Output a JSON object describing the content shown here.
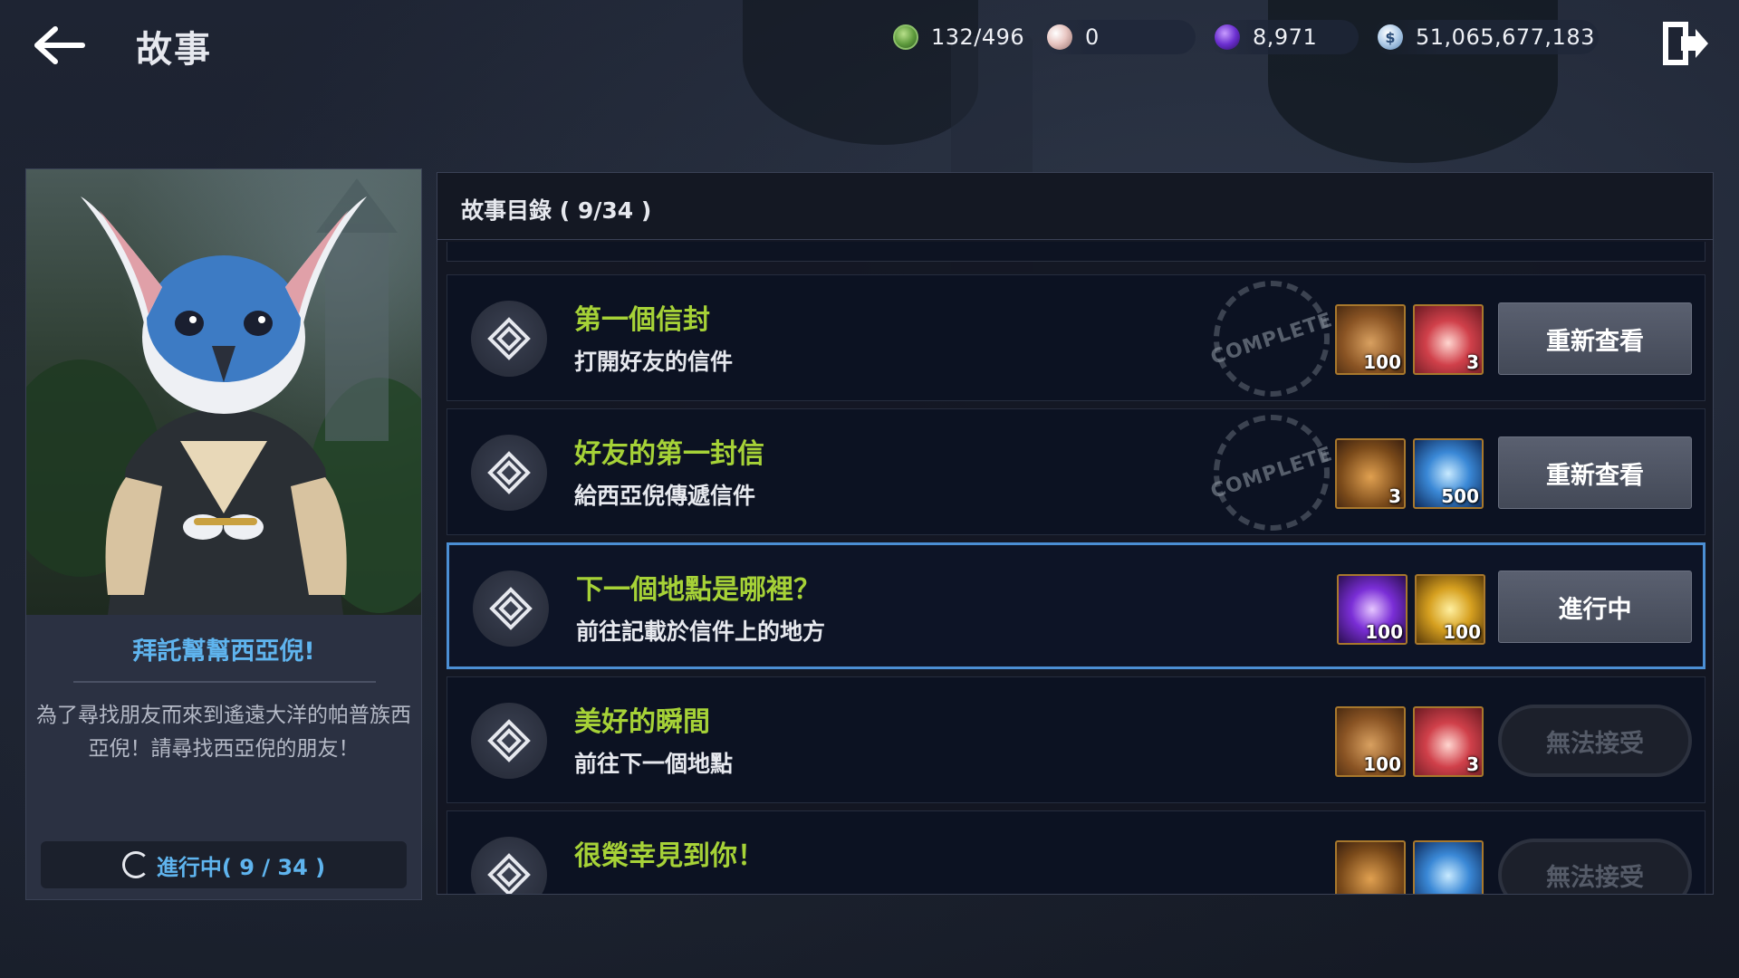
{
  "header": {
    "title": "故事",
    "back_icon": "back-arrow-icon",
    "exit_icon": "exit-icon"
  },
  "currencies": [
    {
      "name": "stamina",
      "value": "132/496"
    },
    {
      "name": "pearl",
      "value": "0"
    },
    {
      "name": "black-gem",
      "value": "8,971"
    },
    {
      "name": "silver",
      "value": "51,065,677,183"
    }
  ],
  "quest_info": {
    "title": "拜託幫幫西亞倪!",
    "description": "為了尋找朋友而來到遙遠大洋的帕普族西亞倪！請尋找西亞倪的朋友！",
    "progress": "進行中( 9 / 34 )"
  },
  "list": {
    "header": "故事目錄 ( 9/34 )",
    "stamp_text": "COMPLETE",
    "rows": [
      {
        "title": "第一個信封",
        "subtitle": "打開好友的信件",
        "completed": true,
        "rewards": [
          {
            "icon": "chest",
            "qty": "100"
          },
          {
            "icon": "gift-box",
            "qty": "3"
          }
        ],
        "action": "重新查看",
        "state": "completed"
      },
      {
        "title": "好友的第一封信",
        "subtitle": "給西亞倪傳遞信件",
        "completed": true,
        "rewards": [
          {
            "icon": "treasure-box",
            "qty": "3"
          },
          {
            "icon": "crystal",
            "qty": "500"
          }
        ],
        "action": "重新查看",
        "state": "completed"
      },
      {
        "title": "下一個地點是哪裡？",
        "subtitle": "前往記載於信件上的地方",
        "completed": false,
        "rewards": [
          {
            "icon": "purple-crystal",
            "qty": "100"
          },
          {
            "icon": "gold-trophy",
            "qty": "100"
          }
        ],
        "action": "進行中",
        "state": "active"
      },
      {
        "title": "美好的瞬間",
        "subtitle": "前往下一個地點",
        "completed": false,
        "rewards": [
          {
            "icon": "chest",
            "qty": "100"
          },
          {
            "icon": "gift-box",
            "qty": "3"
          }
        ],
        "action": "無法接受",
        "state": "locked"
      },
      {
        "title": "很榮幸見到你！",
        "subtitle": "",
        "completed": false,
        "rewards": [
          {
            "icon": "treasure-box",
            "qty": ""
          },
          {
            "icon": "crystal",
            "qty": ""
          }
        ],
        "action": "無法接受",
        "state": "locked"
      }
    ]
  },
  "colors": {
    "accent_blue": "#5fb4ee",
    "quest_title_green": "#a6d237",
    "active_border": "#4b8fd4"
  }
}
